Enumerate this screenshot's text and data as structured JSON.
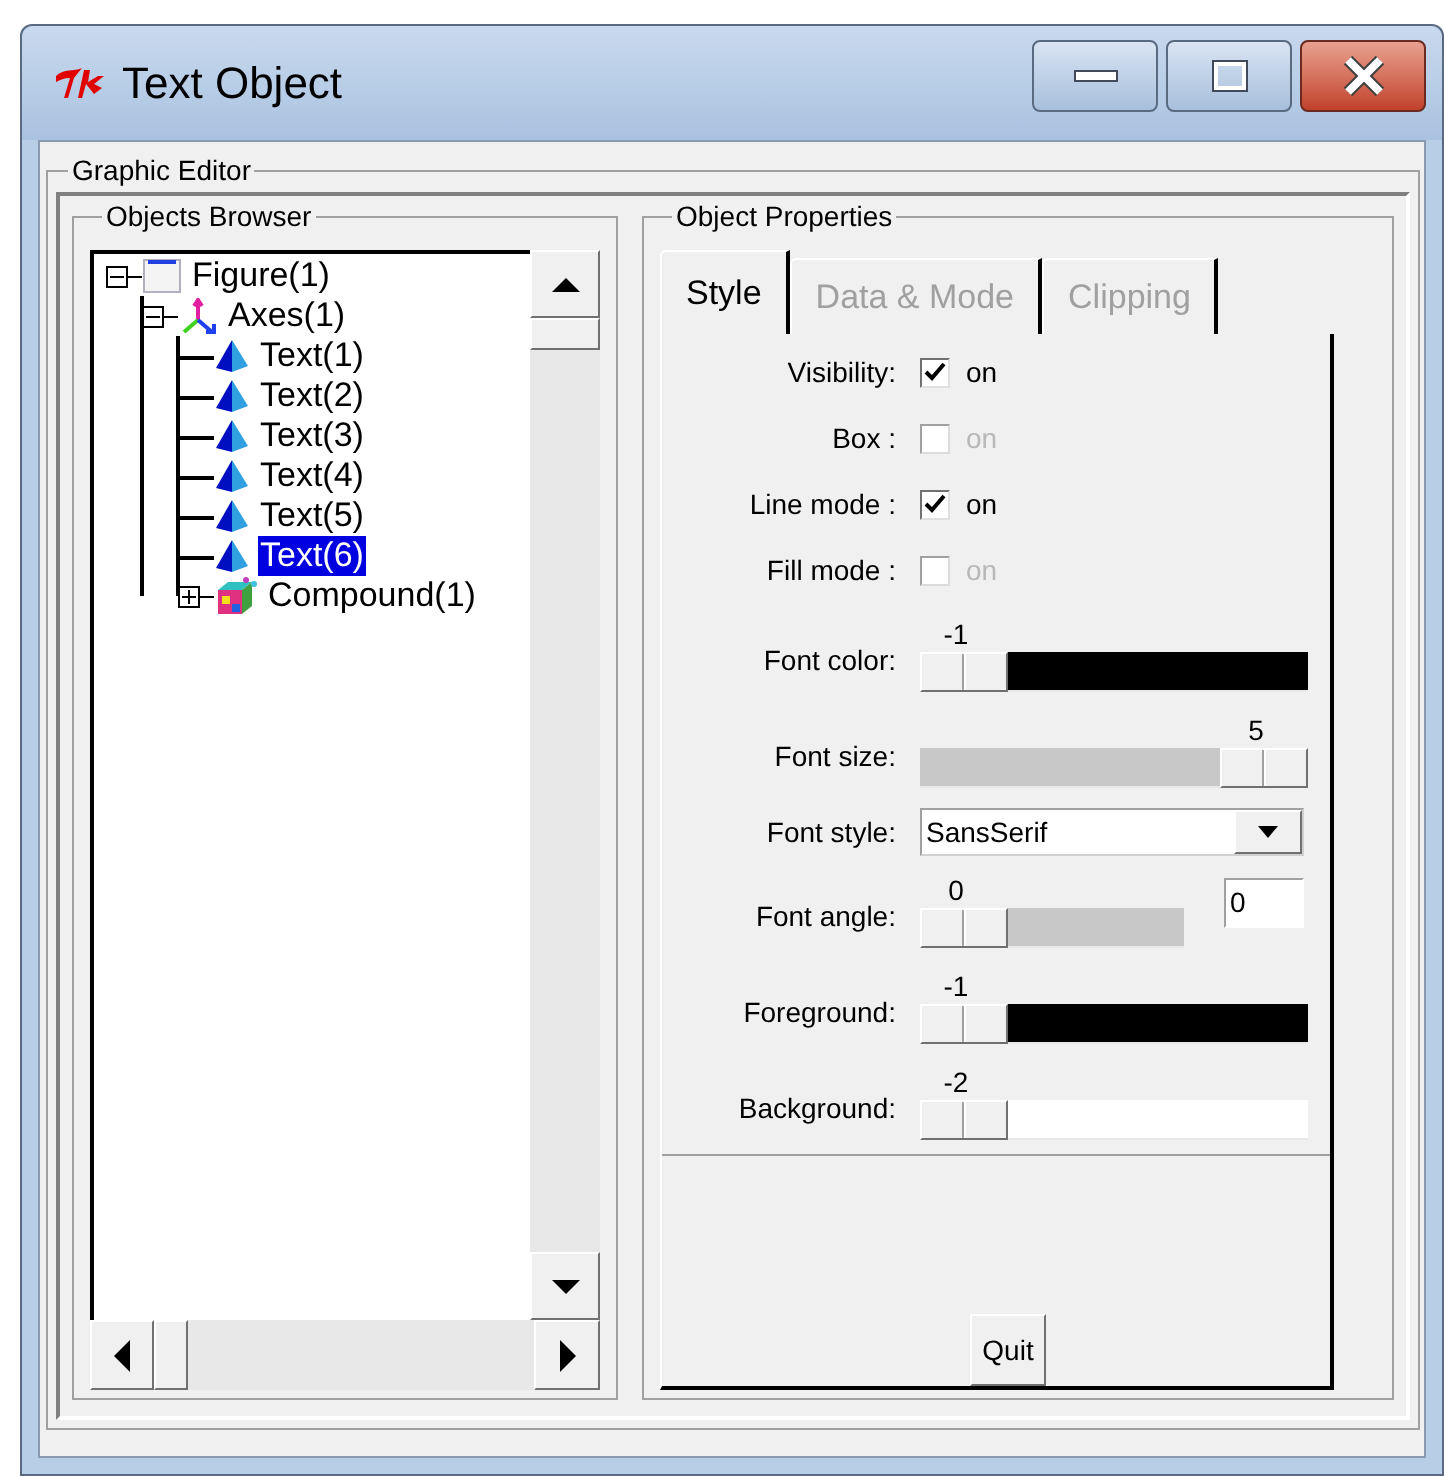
{
  "window": {
    "title": "Text Object"
  },
  "editor": {
    "title": "Graphic Editor"
  },
  "browser": {
    "title": "Objects Browser",
    "tree": [
      {
        "label": "Figure(1)",
        "kind": "figure",
        "expanded": true,
        "selected": false,
        "children": [
          {
            "label": "Axes(1)",
            "kind": "axes",
            "expanded": true,
            "selected": false,
            "children": [
              {
                "label": "Text(1)",
                "kind": "text",
                "selected": false
              },
              {
                "label": "Text(2)",
                "kind": "text",
                "selected": false
              },
              {
                "label": "Text(3)",
                "kind": "text",
                "selected": false
              },
              {
                "label": "Text(4)",
                "kind": "text",
                "selected": false
              },
              {
                "label": "Text(5)",
                "kind": "text",
                "selected": false
              },
              {
                "label": "Text(6)",
                "kind": "text",
                "selected": true
              },
              {
                "label": "Compound(1)",
                "kind": "compound",
                "expanded": false,
                "selected": false
              }
            ]
          }
        ]
      }
    ]
  },
  "properties": {
    "title": "Object Properties",
    "tabs": [
      {
        "label": "Style",
        "selected": true
      },
      {
        "label": "Data & Mode",
        "selected": false
      },
      {
        "label": "Clipping",
        "selected": false
      }
    ],
    "rows": [
      {
        "kind": "checkbox",
        "label": "Visibility:",
        "text": "on",
        "checked": true,
        "disabled": false
      },
      {
        "kind": "checkbox",
        "label": "Box :",
        "text": "on",
        "checked": false,
        "disabled": true
      },
      {
        "kind": "checkbox",
        "label": "Line mode :",
        "text": "on",
        "checked": true,
        "disabled": false
      },
      {
        "kind": "checkbox",
        "label": "Fill mode :",
        "text": "on",
        "checked": false,
        "disabled": true
      },
      {
        "kind": "slider",
        "label": "Font color:",
        "reading": "-1",
        "level": 0,
        "color": "#000000"
      },
      {
        "kind": "slider",
        "label": "Font size:",
        "reading": "5",
        "level": 1,
        "color": "#c8c8c8"
      },
      {
        "kind": "dropdown",
        "label": "Font style:",
        "value": "SansSerif"
      },
      {
        "kind": "slider",
        "label": "Font angle:",
        "reading": "0",
        "level": 0,
        "color": "#c8c8c8",
        "short": true,
        "entry": "0"
      },
      {
        "kind": "slider",
        "label": "Foreground:",
        "reading": "-1",
        "level": 0,
        "color": "#000000"
      },
      {
        "kind": "slider",
        "label": "Background:",
        "reading": "-2",
        "level": 0,
        "color": "#ffffff"
      }
    ],
    "button": "Quit"
  }
}
